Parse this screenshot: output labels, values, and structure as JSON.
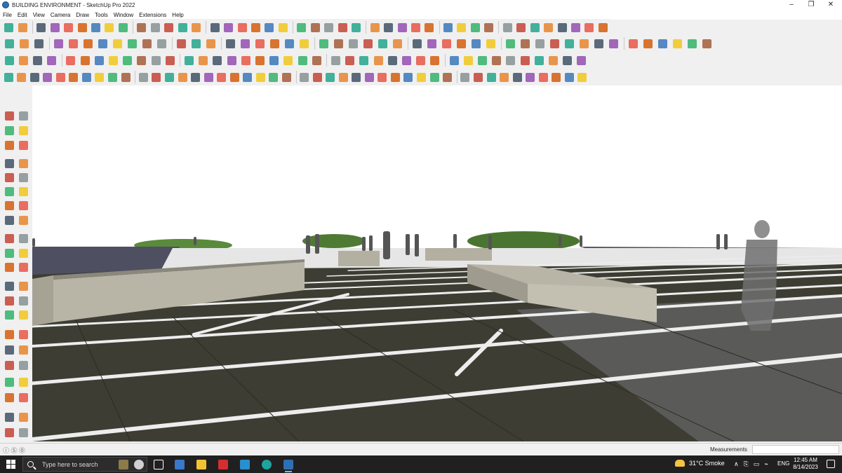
{
  "window": {
    "title": "BUILDING ENVIRONMENT - SketchUp Pro 2022",
    "minimize_glyph": "–",
    "restore_glyph": "❐",
    "close_glyph": "✕"
  },
  "menu": {
    "items": [
      "File",
      "Edit",
      "View",
      "Camera",
      "Draw",
      "Tools",
      "Window",
      "Extensions",
      "Help"
    ]
  },
  "toolbar_rows": {
    "row1_count": 42,
    "row2_count": 46,
    "row3_count": 40,
    "row4_count": 44
  },
  "statusbar": {
    "icons": "ⓘ Ⓢ ⓪",
    "measurements_label": "Measurements",
    "measurements_value": ""
  },
  "taskbar": {
    "search_placeholder": "Type here to search",
    "weather": "31°C  Smoke",
    "tray_glyphs": [
      "∧",
      "⎘",
      "▭",
      "⌁"
    ],
    "language": "ENG",
    "time": "12:45 AM",
    "date": "8/14/2023"
  },
  "colors": {
    "sky": "#ffffff",
    "ground": "#3d3d33",
    "stripe": "#ededed",
    "planter": "#b8b5a6",
    "hills": "#4f7a34",
    "water": "#4e4f61",
    "taskbar": "#202020"
  }
}
